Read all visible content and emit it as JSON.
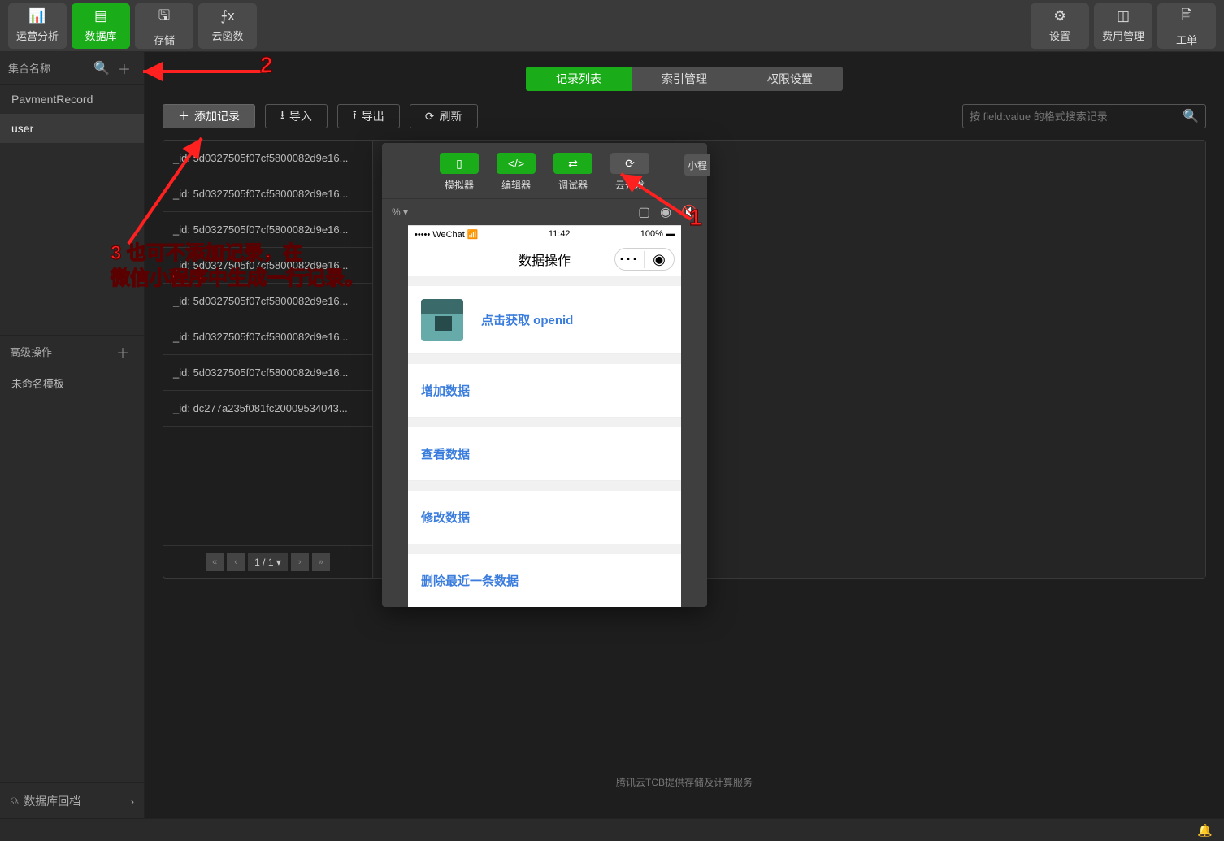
{
  "toolbar": {
    "left": [
      {
        "icon": "📊",
        "label": "运营分析",
        "active": false
      },
      {
        "icon": "▤",
        "label": "数据库",
        "active": true
      },
      {
        "icon": "🖫",
        "label": "存储",
        "active": false
      },
      {
        "icon": "⨍x",
        "label": "云函数",
        "active": false
      }
    ],
    "right": [
      {
        "icon": "⚙",
        "label": "设置"
      },
      {
        "icon": "◫",
        "label": "费用管理"
      },
      {
        "icon": "🖹",
        "label": "工单"
      }
    ]
  },
  "sidebar": {
    "collections_header": "集合名称",
    "collections": [
      "PavmentRecord",
      "user"
    ],
    "selected_collection": "user",
    "advanced_header": "高级操作",
    "templates": [
      "未命名模板"
    ],
    "rollback": "数据库回档"
  },
  "tabs": [
    "记录列表",
    "索引管理",
    "权限设置"
  ],
  "active_tab": "记录列表",
  "actions": {
    "add": "添加记录",
    "import": "导入",
    "export": "导出",
    "refresh": "刷新"
  },
  "search_placeholder": "按 field:value 的格式搜索记录",
  "records": [
    "_id: 5d0327505f07cf5800082d9e16...",
    "_id: 5d0327505f07cf5800082d9e16...",
    "_id: 5d0327505f07cf5800082d9e16...",
    "_id: 5d0327505f07cf5800082d9e16...",
    "_id: 5d0327505f07cf5800082d9e16...",
    "_id: 5d0327505f07cf5800082d9e16...",
    "_id: 5d0327505f07cf5800082d9e16...",
    "_id: dc277a235f081fc20009534043..."
  ],
  "pager": "1 / 1",
  "footer_note": "腾讯云TCB提供存储及计算服务",
  "overlay": {
    "tools": [
      {
        "icon": "▯",
        "label": "模拟器",
        "green": true
      },
      {
        "icon": "</>",
        "label": "编辑器",
        "green": true
      },
      {
        "icon": "⇄",
        "label": "调试器",
        "green": true
      },
      {
        "icon": "⟳",
        "label": "云开发",
        "green": false
      }
    ],
    "small_tab": "小程",
    "zoom": "% ▾"
  },
  "phone": {
    "carrier": "••••• WeChat",
    "time": "11:42",
    "battery": "100%",
    "title": "数据操作",
    "openid": "点击获取 openid",
    "rows": [
      "增加数据",
      "查看数据",
      "修改数据",
      "删除最近一条数据"
    ]
  },
  "annotations": {
    "num1": "1",
    "num2": "2",
    "text3": "3 也可不添加记录，在\n微信小程序中生成一行记录。"
  }
}
